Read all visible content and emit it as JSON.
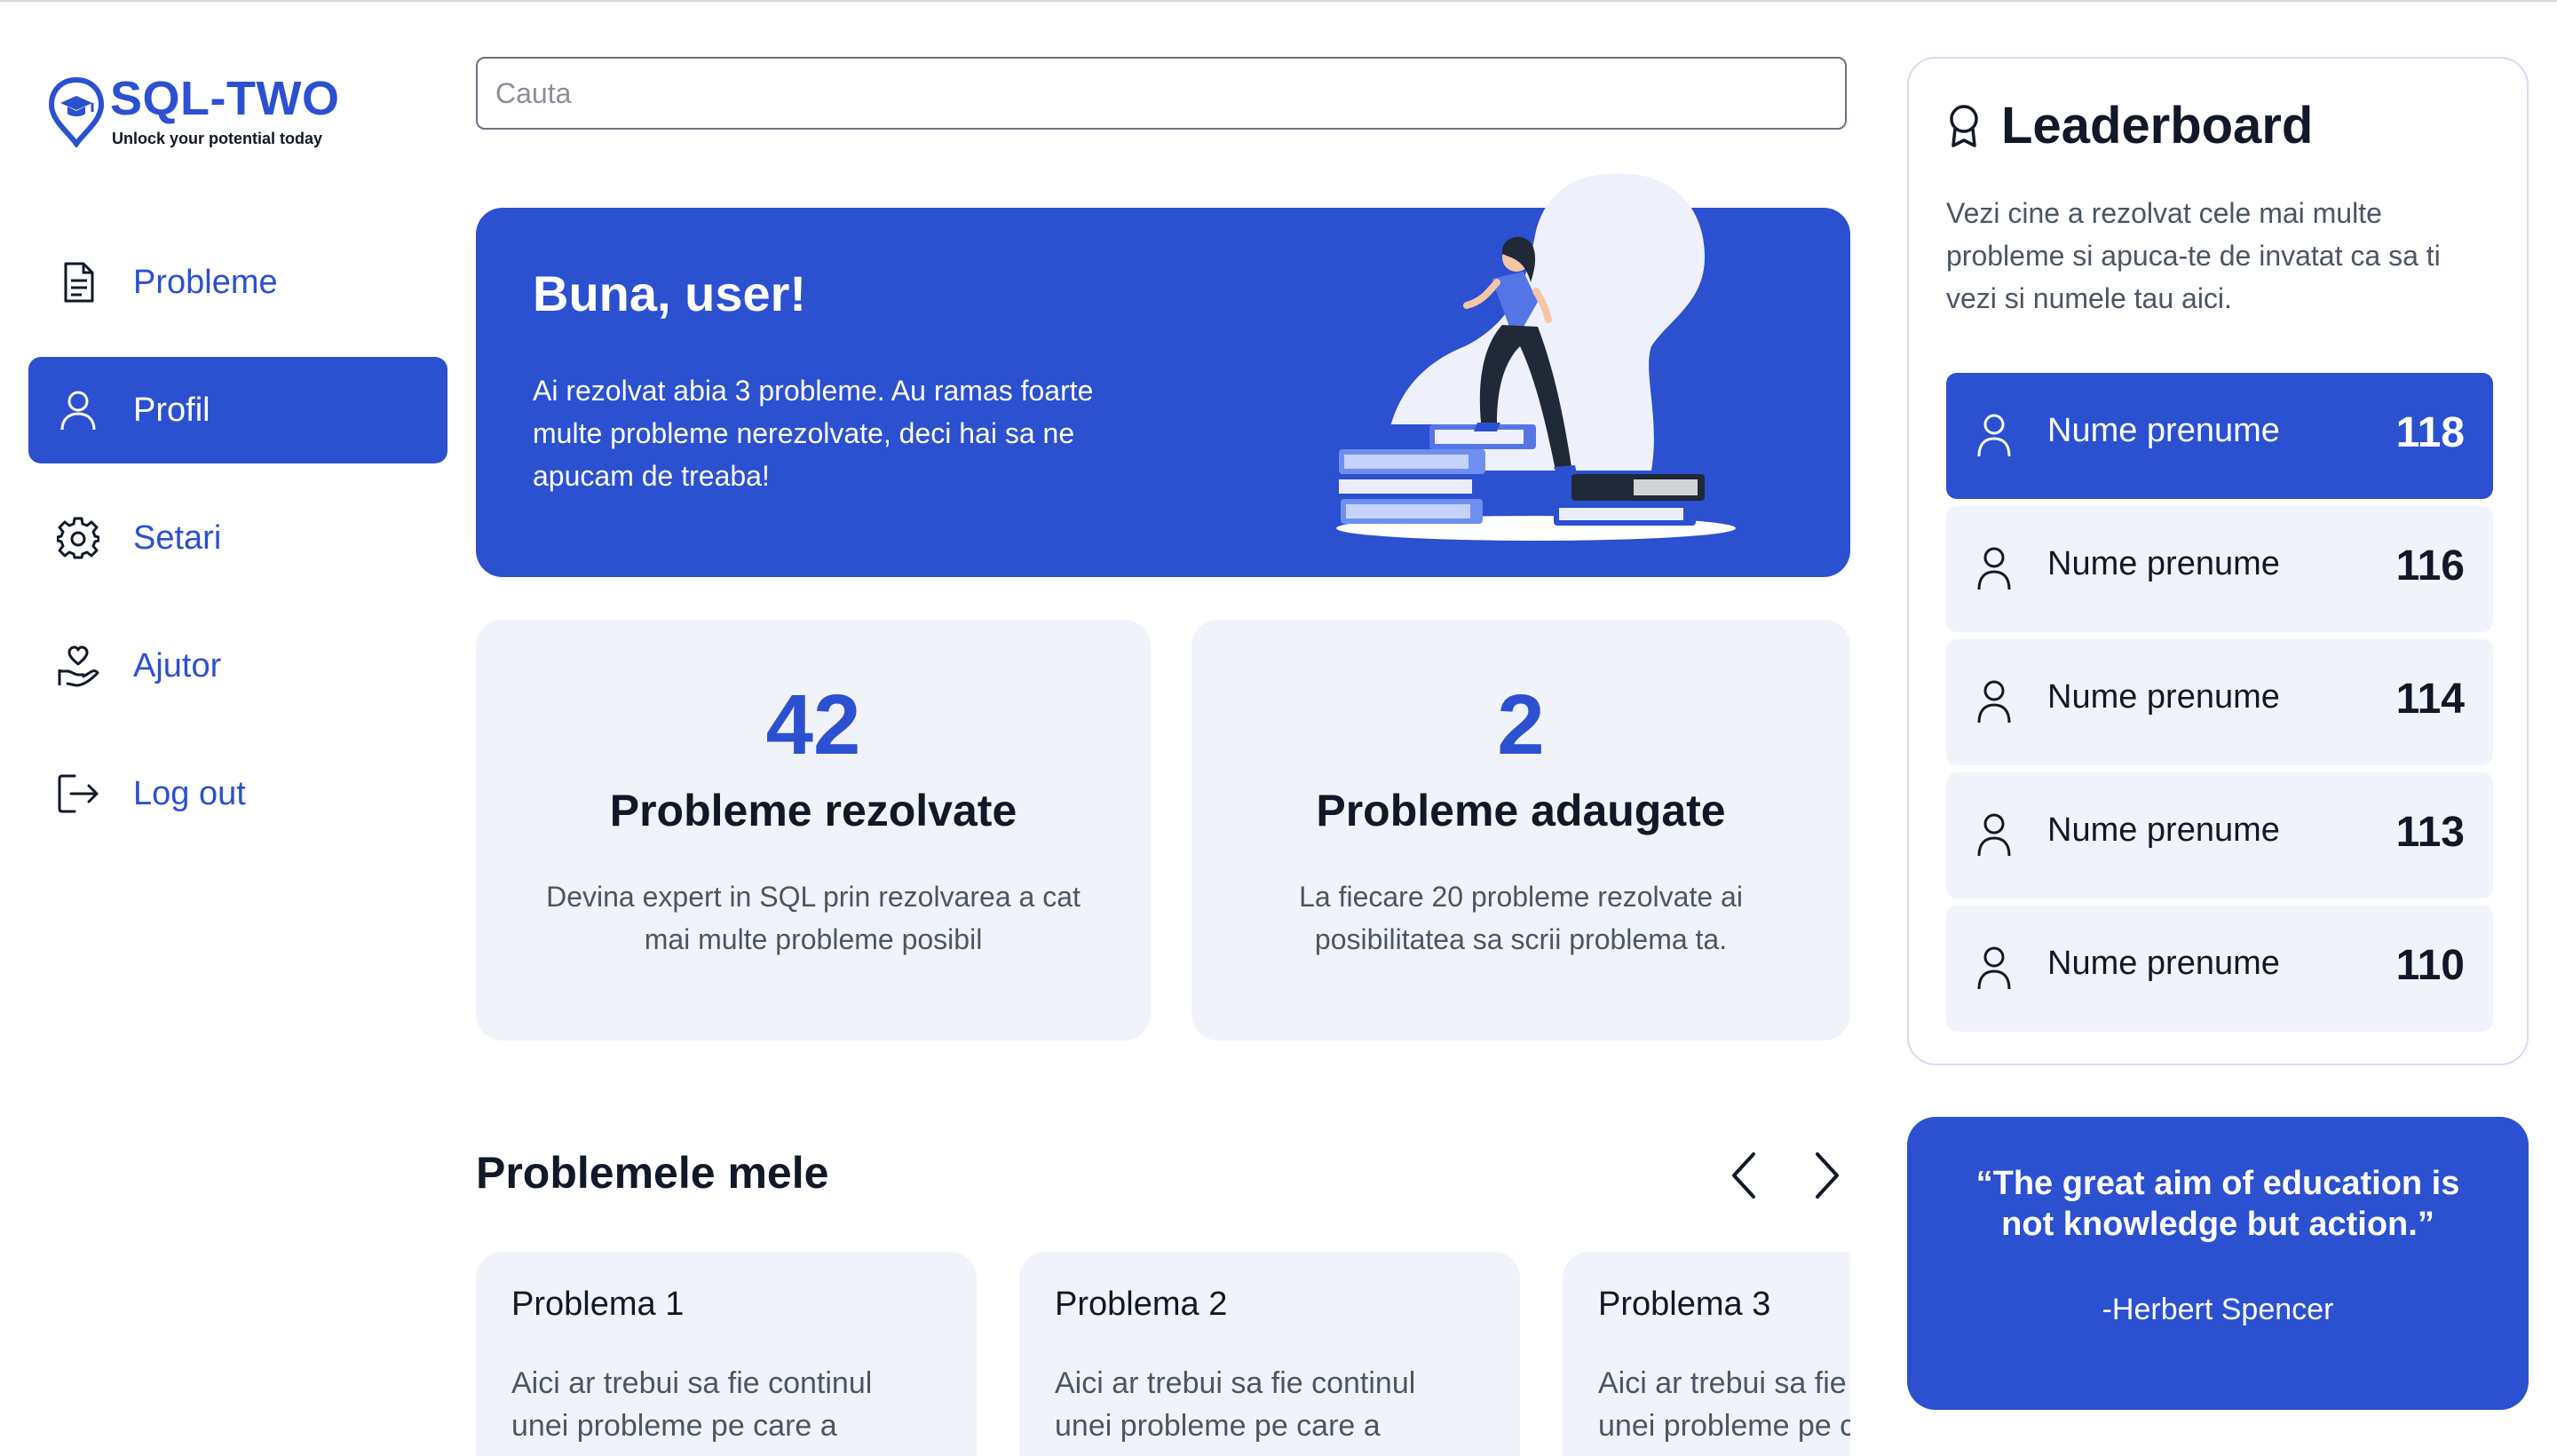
{
  "brand": {
    "name": "SQL-TWO",
    "tagline": "Unlock your potential today"
  },
  "colors": {
    "accent": "#2b50d0",
    "card_bg": "#f1f3fb"
  },
  "sidebar": {
    "items": [
      {
        "label": "Probleme",
        "icon": "document-icon",
        "active": false
      },
      {
        "label": "Profil",
        "icon": "user-icon",
        "active": true
      },
      {
        "label": "Setari",
        "icon": "gear-icon",
        "active": false
      },
      {
        "label": "Ajutor",
        "icon": "helping-hand-icon",
        "active": false
      },
      {
        "label": "Log out",
        "icon": "logout-icon",
        "active": false
      }
    ]
  },
  "search": {
    "placeholder": "Cauta",
    "value": ""
  },
  "hero": {
    "title": "Buna, user!",
    "text": "Ai rezolvat abia 3 probleme. Au ramas foarte multe probleme nerezolvate, deci hai sa ne apucam de treaba!"
  },
  "stats": [
    {
      "value": "42",
      "title": "Probleme rezolvate",
      "description": "Devina expert in SQL prin rezolvarea a cat mai multe probleme posibil"
    },
    {
      "value": "2",
      "title": "Probleme adaugate",
      "description": "La fiecare 20 probleme rezolvate ai posibilitatea sa scrii problema ta."
    }
  ],
  "problems": {
    "title": "Problemele mele",
    "items": [
      {
        "title": "Problema 1",
        "description_line1": "Aici ar trebui sa fie continul",
        "description_line2": "unei probleme pe care a"
      },
      {
        "title": "Problema 2",
        "description_line1": "Aici ar trebui sa fie continul",
        "description_line2": "unei probleme pe care a"
      },
      {
        "title": "Problema 3",
        "description_line1": "Aici ar trebui sa fie continul",
        "description_line2": "unei probleme pe care a"
      }
    ]
  },
  "leaderboard": {
    "title": "Leaderboard",
    "description": "Vezi cine a rezolvat cele mai multe probleme si apuca-te de invatat ca sa ti vezi si numele tau aici.",
    "entries": [
      {
        "name": "Nume prenume",
        "score": "118"
      },
      {
        "name": "Nume prenume",
        "score": "116"
      },
      {
        "name": "Nume prenume",
        "score": "114"
      },
      {
        "name": "Nume prenume",
        "score": "113"
      },
      {
        "name": "Nume prenume",
        "score": "110"
      }
    ]
  },
  "quote": {
    "text": "“The great aim of education is not knowledge but action.”",
    "author": "-Herbert Spencer"
  }
}
